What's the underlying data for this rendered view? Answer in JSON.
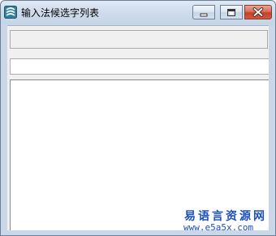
{
  "window": {
    "title": "输入法候选字列表",
    "buttons": {
      "minimize_icon": "minimize-icon",
      "maximize_icon": "maximize-icon",
      "close_icon": "close-icon"
    }
  },
  "form": {
    "readonly_field_value": "",
    "input_field_value": "",
    "candidate_list_items": []
  },
  "watermark": {
    "site_name": "易语言资源网",
    "site_url": "www.e5a5x.com"
  },
  "colors": {
    "watermark": "#1a4fbf",
    "close_button": "#c3412a",
    "title_bar": "#cfdcec"
  }
}
